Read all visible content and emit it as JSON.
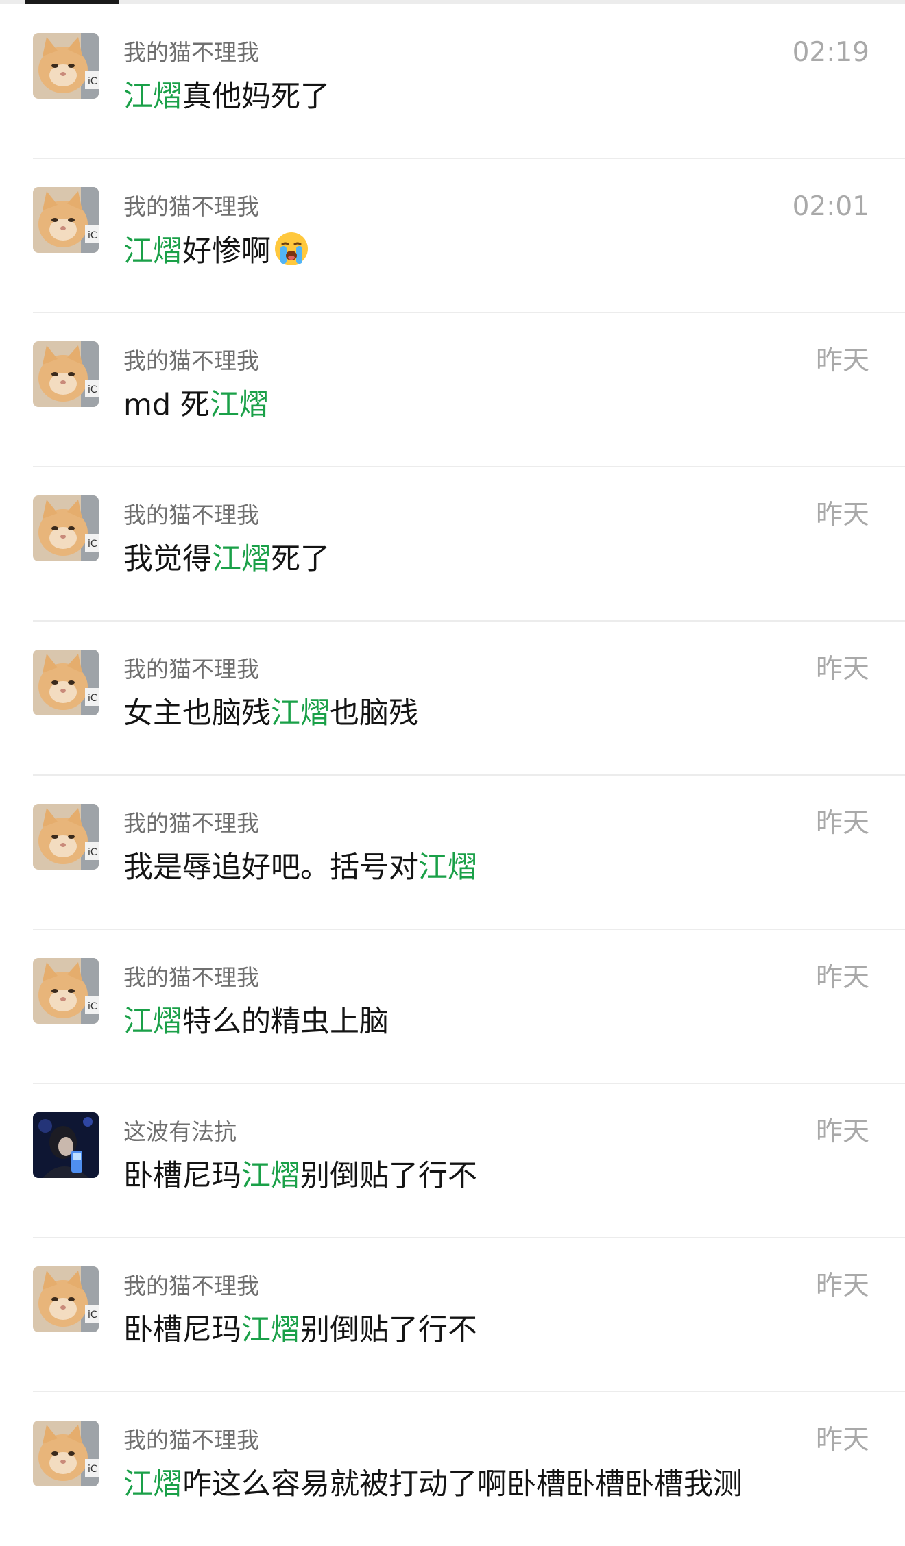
{
  "search_results": {
    "items": [
      {
        "avatar": "kitten-avatar",
        "sender": "我的猫不理我",
        "time": "02:19",
        "message": {
          "before": "",
          "keyword": "江熠",
          "after": "真他妈死了"
        }
      },
      {
        "avatar": "kitten-avatar",
        "sender": "我的猫不理我",
        "time": "02:01",
        "message": {
          "before": "",
          "keyword": "江熠",
          "after": "好惨啊"
        },
        "emoji": "loudly-crying-face-emoji"
      },
      {
        "avatar": "kitten-avatar",
        "sender": "我的猫不理我",
        "time": "昨天",
        "message": {
          "before": "md 死",
          "keyword": "江熠",
          "after": ""
        }
      },
      {
        "avatar": "kitten-avatar",
        "sender": "我的猫不理我",
        "time": "昨天",
        "message": {
          "before": "我觉得",
          "keyword": "江熠",
          "after": "死了"
        }
      },
      {
        "avatar": "kitten-avatar",
        "sender": "我的猫不理我",
        "time": "昨天",
        "message": {
          "before": "女主也脑残",
          "keyword": "江熠",
          "after": "也脑残"
        }
      },
      {
        "avatar": "kitten-avatar",
        "sender": "我的猫不理我",
        "time": "昨天",
        "message": {
          "before": "我是辱追好吧。括号对",
          "keyword": "江熠",
          "after": ""
        }
      },
      {
        "avatar": "kitten-avatar",
        "sender": "我的猫不理我",
        "time": "昨天",
        "message": {
          "before": "",
          "keyword": "江熠",
          "after": "特么的精虫上脑"
        }
      },
      {
        "avatar": "person-night-avatar",
        "sender": "这波有法抗",
        "time": "昨天",
        "message": {
          "before": "卧槽尼玛",
          "keyword": "江熠",
          "after": "别倒贴了行不"
        }
      },
      {
        "avatar": "kitten-avatar",
        "sender": "我的猫不理我",
        "time": "昨天",
        "message": {
          "before": "卧槽尼玛",
          "keyword": "江熠",
          "after": "别倒贴了行不"
        }
      },
      {
        "avatar": "kitten-avatar",
        "sender": "我的猫不理我",
        "time": "昨天",
        "message": {
          "before": "",
          "keyword": "江熠",
          "after": "咋这么容易就被打动了啊卧槽卧槽卧槽我测"
        }
      }
    ]
  },
  "colors": {
    "keyword_highlight": "#1aa048",
    "sender_text": "#6f6f6f",
    "time_text": "#a9a9a9",
    "message_text": "#141414",
    "divider": "#ececec"
  }
}
